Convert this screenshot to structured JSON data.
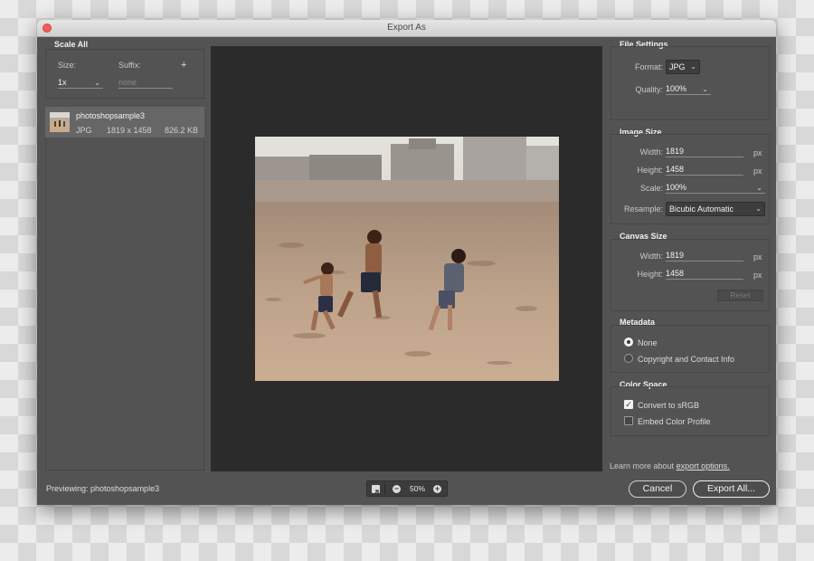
{
  "window": {
    "title": "Export As"
  },
  "scale_all": {
    "title": "Scale All",
    "size_label": "Size:",
    "suffix_label": "Suffix:",
    "add_symbol": "+",
    "size_value": "1x",
    "suffix_placeholder": "none"
  },
  "asset": {
    "name": "photoshopsample3",
    "format": "JPG",
    "dimensions": "1819 x 1458",
    "file_size": "826.2 KB"
  },
  "file_settings": {
    "title": "File Settings",
    "format_label": "Format:",
    "format_value": "JPG",
    "quality_label": "Quality:",
    "quality_value": "100%"
  },
  "image_size": {
    "title": "Image Size",
    "width_label": "Width:",
    "width_value": "1819",
    "height_label": "Height:",
    "height_value": "1458",
    "scale_label": "Scale:",
    "scale_value": "100%",
    "resample_label": "Resample:",
    "resample_value": "Bicubic Automatic",
    "unit": "px"
  },
  "canvas_size": {
    "title": "Canvas Size",
    "width_label": "Width:",
    "width_value": "1819",
    "height_label": "Height:",
    "height_value": "1458",
    "reset_label": "Reset",
    "unit": "px"
  },
  "metadata": {
    "title": "Metadata",
    "options": [
      "None",
      "Copyright and Contact Info"
    ],
    "selected": "None"
  },
  "color_space": {
    "title": "Color Space",
    "convert_label": "Convert to sRGB",
    "convert_checked": true,
    "embed_label": "Embed Color Profile",
    "embed_checked": false
  },
  "learn_more": {
    "prefix": "Learn more about",
    "link": "export options."
  },
  "footer": {
    "previewing": "Previewing: photoshopsample3",
    "zoom": "50%",
    "cancel_label": "Cancel",
    "export_label": "Export All..."
  },
  "icons": {
    "close": "close-dot",
    "zoom_out": "minus-icon",
    "zoom_in": "plus-icon",
    "fit": "fit-view-icon"
  }
}
